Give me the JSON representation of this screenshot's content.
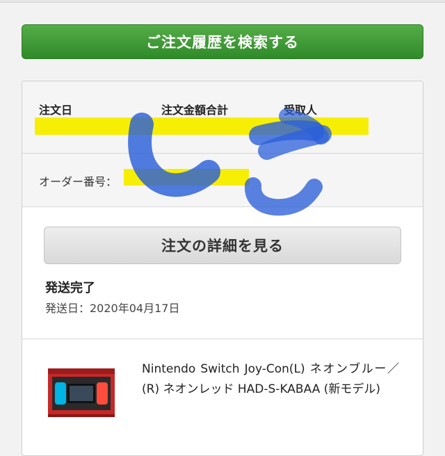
{
  "search_button": {
    "label": "ご注文履歴を検索する"
  },
  "order": {
    "columns": [
      {
        "label": "注文日"
      },
      {
        "label": "注文金額合計"
      },
      {
        "label": "受取人"
      }
    ],
    "order_number_label": "オーダー番号：",
    "details_button": "注文の詳細を見る",
    "status": "発送完了",
    "ship_date": "発送日：2020年04月17日"
  },
  "item": {
    "name": "Nintendo Switch Joy-Con(L) ネオンブルー／(R) ネオンレッド HAD-S-KABAA (新モデル)"
  },
  "colors": {
    "green_button": "#3a9a32",
    "redaction_yellow": "#f7ee05",
    "redaction_blue": "#2b5fd9",
    "joycon_blue": "#00b4e6",
    "joycon_red": "#ff4c3c"
  }
}
